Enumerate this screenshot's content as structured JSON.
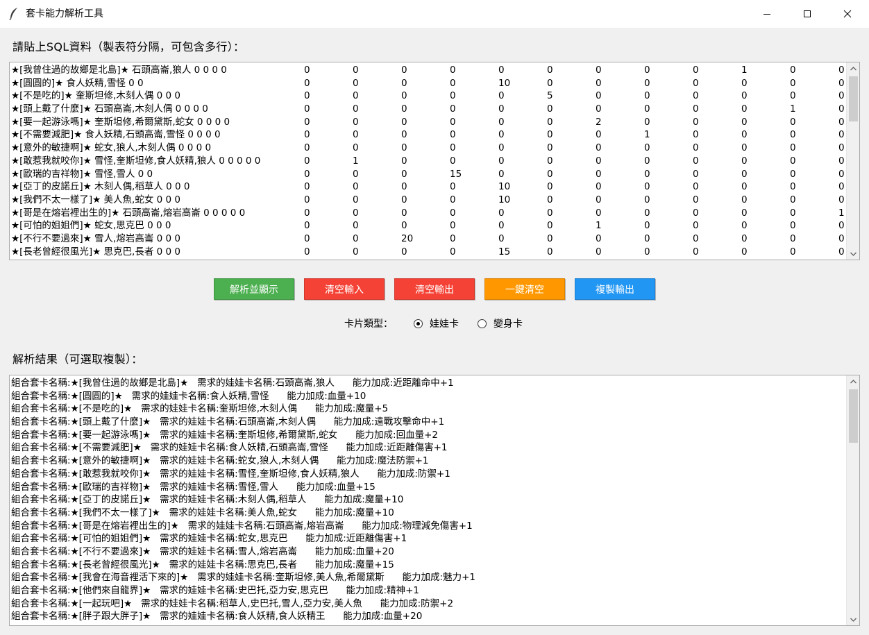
{
  "window": {
    "title": "套卡能力解析工具"
  },
  "input_label": "請貼上SQL資料（製表符分隔，可包含多行）：",
  "input_rows": [
    {
      "name": "★[我曾住過的故鄉是北島]★ 石頭高崙,狼人 0 0 0 0",
      "cols": [
        "0",
        "0",
        "0",
        "0",
        "0",
        "0",
        "0",
        "0",
        "0",
        "1",
        "0",
        "0"
      ]
    },
    {
      "name": "★[圓圓的]★ 食人妖精,雪怪 0 0",
      "cols": [
        "0",
        "0",
        "0",
        "0",
        "10",
        "0",
        "0",
        "0",
        "0",
        "0",
        "0",
        "0"
      ]
    },
    {
      "name": "★[不是吃的]★ 奎斯坦修,木刻人偶 0 0 0",
      "cols": [
        "0",
        "0",
        "0",
        "0",
        "0",
        "5",
        "0",
        "0",
        "0",
        "0",
        "0",
        "0"
      ]
    },
    {
      "name": "★[頭上戴了什麼]★ 石頭高崙,木刻人偶 0 0 0 0",
      "cols": [
        "0",
        "0",
        "0",
        "0",
        "0",
        "0",
        "0",
        "0",
        "0",
        "0",
        "1",
        "0"
      ]
    },
    {
      "name": "★[要一起游泳嗎]★ 奎斯坦修,希爾黛斯,蛇女 0 0 0 0",
      "cols": [
        "0",
        "0",
        "0",
        "0",
        "0",
        "0",
        "2",
        "0",
        "0",
        "0",
        "0",
        "0"
      ]
    },
    {
      "name": "★[不需要減肥]★ 食人妖精,石頭高崙,雪怪 0 0 0 0",
      "cols": [
        "0",
        "0",
        "0",
        "0",
        "0",
        "0",
        "0",
        "1",
        "0",
        "0",
        "0",
        "0"
      ]
    },
    {
      "name": "★[意外的敏捷啊]★ 蛇女,狼人,木刻人偶 0 0 0 0",
      "cols": [
        "0",
        "0",
        "0",
        "0",
        "0",
        "0",
        "0",
        "0",
        "0",
        "0",
        "0",
        "0"
      ]
    },
    {
      "name": "★[敢惹我就咬你]★ 雪怪,奎斯坦修,食人妖精,狼人 0 0 0 0 0",
      "cols": [
        "0",
        "1",
        "0",
        "0",
        "0",
        "0",
        "0",
        "0",
        "0",
        "0",
        "0",
        "0"
      ]
    },
    {
      "name": "★[歐瑞的吉祥物]★ 雪怪,雪人 0 0",
      "cols": [
        "0",
        "0",
        "0",
        "15",
        "0",
        "0",
        "0",
        "0",
        "0",
        "0",
        "0",
        "0"
      ]
    },
    {
      "name": "★[亞丁的皮諾丘]★ 木刻人偶,稻草人 0 0 0",
      "cols": [
        "0",
        "0",
        "0",
        "0",
        "10",
        "0",
        "0",
        "0",
        "0",
        "0",
        "0",
        "0"
      ]
    },
    {
      "name": "★[我們不太一樣了]★ 美人魚,蛇女 0 0 0",
      "cols": [
        "0",
        "0",
        "0",
        "0",
        "10",
        "0",
        "0",
        "0",
        "0",
        "0",
        "0",
        "0"
      ]
    },
    {
      "name": "★[哥是在熔岩裡出生的]★ 石頭高崙,熔岩高崙 0 0 0 0 0",
      "cols": [
        "0",
        "0",
        "0",
        "0",
        "0",
        "0",
        "0",
        "0",
        "0",
        "0",
        "0",
        "1"
      ]
    },
    {
      "name": "★[可怕的姐姐們]★ 蛇女,思克巴 0 0 0",
      "cols": [
        "0",
        "0",
        "0",
        "0",
        "0",
        "0",
        "1",
        "0",
        "0",
        "0",
        "0",
        "0"
      ]
    },
    {
      "name": "★[不行不要過來]★ 雪人,熔岩高崙 0 0 0",
      "cols": [
        "0",
        "0",
        "20",
        "0",
        "0",
        "0",
        "0",
        "0",
        "0",
        "0",
        "0",
        "0"
      ]
    },
    {
      "name": "★[長老曾經很風光]★ 思克巴,長者 0 0 0",
      "cols": [
        "0",
        "0",
        "0",
        "0",
        "15",
        "0",
        "0",
        "0",
        "0",
        "0",
        "0",
        "0"
      ]
    }
  ],
  "buttons": {
    "parse": "解析並顯示",
    "clear_input": "清空輸入",
    "clear_output": "清空輸出",
    "clear_all": "一鍵清空",
    "copy_output": "複製輸出"
  },
  "colors": {
    "parse": "#4caf50",
    "clear_input": "#f44336",
    "clear_output": "#f44336",
    "clear_all": "#ff9800",
    "copy_output": "#2196f3"
  },
  "card_type": {
    "label": "卡片類型：",
    "options": [
      "娃娃卡",
      "變身卡"
    ],
    "selected": "娃娃卡"
  },
  "output_label": "解析結果（可選取複製）：",
  "output_lines": [
    "組合套卡名稱:★[我曾住過的故鄉是北島]★   需求的娃娃卡名稱:石頭高崙,狼人      能力加成:近距離命中+1",
    "組合套卡名稱:★[圓圓的]★   需求的娃娃卡名稱:食人妖精,雪怪      能力加成:血量+10",
    "組合套卡名稱:★[不是吃的]★   需求的娃娃卡名稱:奎斯坦修,木刻人偶      能力加成:魔量+5",
    "組合套卡名稱:★[頭上戴了什麼]★   需求的娃娃卡名稱:石頭高崙,木刻人偶      能力加成:遠戰攻擊命中+1",
    "組合套卡名稱:★[要一起游泳嗎]★   需求的娃娃卡名稱:奎斯坦修,希爾黛斯,蛇女      能力加成:回血量+2",
    "組合套卡名稱:★[不需要減肥]★   需求的娃娃卡名稱:食人妖精,石頭高崙,雪怪      能力加成:近距離傷害+1",
    "組合套卡名稱:★[意外的敏捷啊]★   需求的娃娃卡名稱:蛇女,狼人,木刻人偶      能力加成:魔法防禦+1",
    "組合套卡名稱:★[敢惹我就咬你]★   需求的娃娃卡名稱:雪怪,奎斯坦修,食人妖精,狼人      能力加成:防禦+1",
    "組合套卡名稱:★[歐瑞的吉祥物]★   需求的娃娃卡名稱:雪怪,雪人      能力加成:血量+15",
    "組合套卡名稱:★[亞丁的皮諾丘]★   需求的娃娃卡名稱:木刻人偶,稻草人      能力加成:魔量+10",
    "組合套卡名稱:★[我們不太一樣了]★   需求的娃娃卡名稱:美人魚,蛇女      能力加成:魔量+10",
    "組合套卡名稱:★[哥是在熔岩裡出生的]★   需求的娃娃卡名稱:石頭高崙,熔岩高崙      能力加成:物理減免傷害+1",
    "組合套卡名稱:★[可怕的姐姐們]★   需求的娃娃卡名稱:蛇女,思克巴      能力加成:近距離傷害+1",
    "組合套卡名稱:★[不行不要過來]★   需求的娃娃卡名稱:雪人,熔岩高崙      能力加成:血量+20",
    "組合套卡名稱:★[長老曾經很風光]★   需求的娃娃卡名稱:思克巴,長者      能力加成:魔量+15",
    "組合套卡名稱:★[我會在海音裡活下來的]★   需求的娃娃卡名稱:奎斯坦修,美人魚,希爾黛斯      能力加成:魅力+1",
    "組合套卡名稱:★[他們來自龍界]★   需求的娃娃卡名稱:史巴托,亞力安,思克巴      能力加成:精神+1",
    "組合套卡名稱:★[一起玩吧]★   需求的娃娃卡名稱:稻草人,史巴托,雪人,亞力安,美人魚      能力加成:防禦+2",
    "組合套卡名稱:★[胖子跟大胖子]★   需求的娃娃卡名稱:食人妖精,食人妖精王      能力加成:血量+20"
  ]
}
